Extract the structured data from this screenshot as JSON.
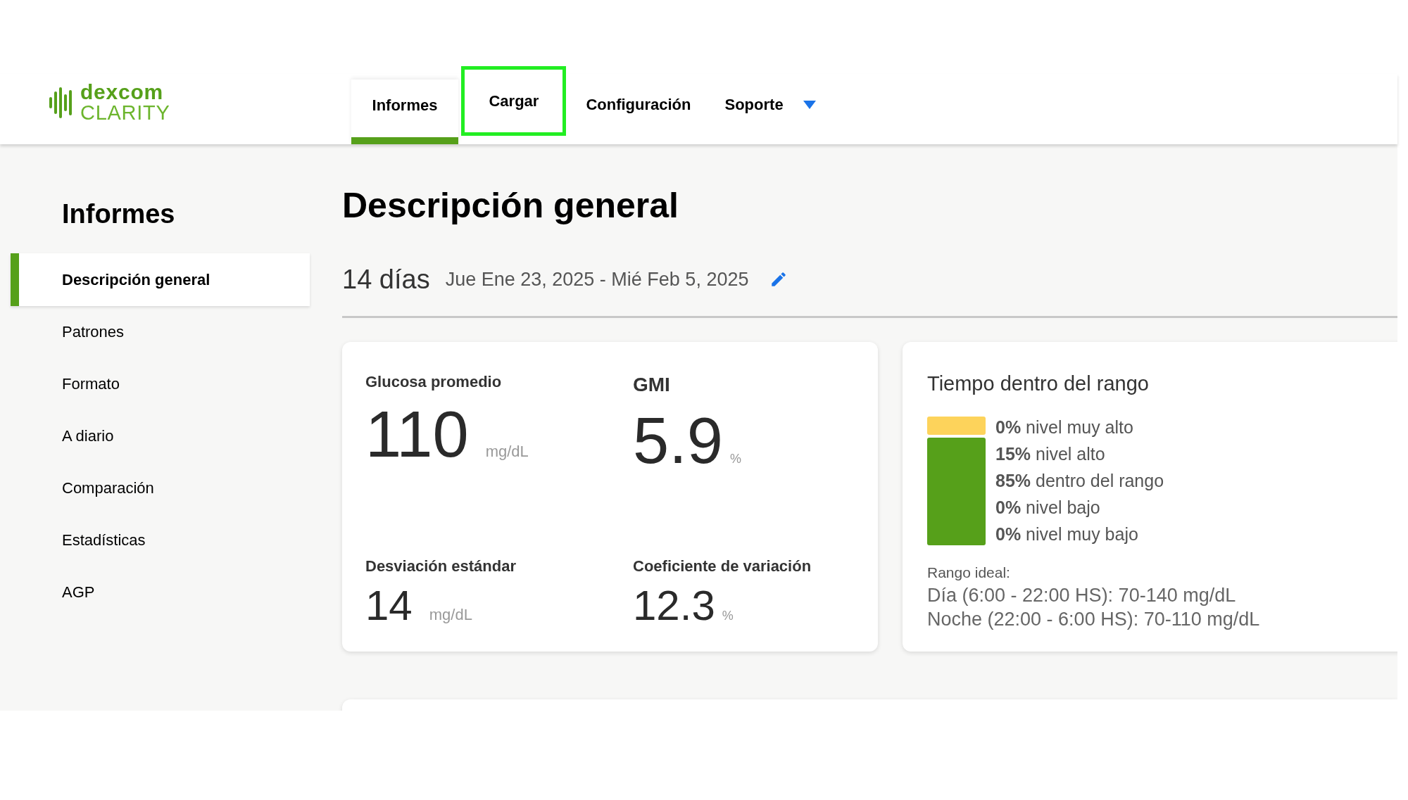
{
  "logo": {
    "line1": "dexcom",
    "line2": "CLARITY"
  },
  "nav": [
    {
      "label": "Informes",
      "selected": true,
      "highlighted": false,
      "kind": "tab"
    },
    {
      "label": "Cargar",
      "selected": false,
      "highlighted": true,
      "kind": "tab"
    },
    {
      "label": "Configuración",
      "selected": false,
      "highlighted": false,
      "kind": "tab"
    },
    {
      "label": "Soporte",
      "selected": false,
      "highlighted": false,
      "kind": "dropdown"
    }
  ],
  "sidebar": {
    "title": "Informes",
    "items": [
      {
        "label": "Descripción general",
        "selected": true
      },
      {
        "label": "Patrones",
        "selected": false
      },
      {
        "label": "Formato",
        "selected": false
      },
      {
        "label": "A diario",
        "selected": false
      },
      {
        "label": "Comparación",
        "selected": false
      },
      {
        "label": "Estadísticas",
        "selected": false
      },
      {
        "label": "AGP",
        "selected": false
      }
    ]
  },
  "page": {
    "title": "Descripción general",
    "period": "14 días",
    "date_range": "Jue Ene 23, 2025 - Mié Feb 5, 2025"
  },
  "stats": {
    "primary": [
      {
        "label": "Glucosa promedio",
        "value": "110",
        "unit": "mg/dL"
      },
      {
        "label": "GMI",
        "value": "5.9",
        "unit": "%"
      }
    ],
    "secondary": [
      {
        "label": "Desviación estándar",
        "value": "14",
        "unit": "mg/dL"
      },
      {
        "label": "Coeficiente de variación",
        "value": "12.3",
        "unit": "%"
      }
    ]
  },
  "time_in_range": {
    "title": "Tiempo dentro del rango",
    "bar_segments": [
      {
        "color": "#fdd35b",
        "level": 0.15
      },
      {
        "color": "#56a01a",
        "level": 0.85
      }
    ],
    "legend": [
      "**0%** nivel muy alto",
      "**15%** nivel alto",
      "**85%** dentro del rango",
      "**0%** nivel bajo",
      "**0%** nivel muy bajo"
    ],
    "ideal_label": "Rango ideal:",
    "ideal_lines": [
      "Día (6:00 - 22:00 HS): 70-140 mg/dL",
      "Noche (22:00 - 6:00 HS): 70-110 mg/dL"
    ]
  }
}
